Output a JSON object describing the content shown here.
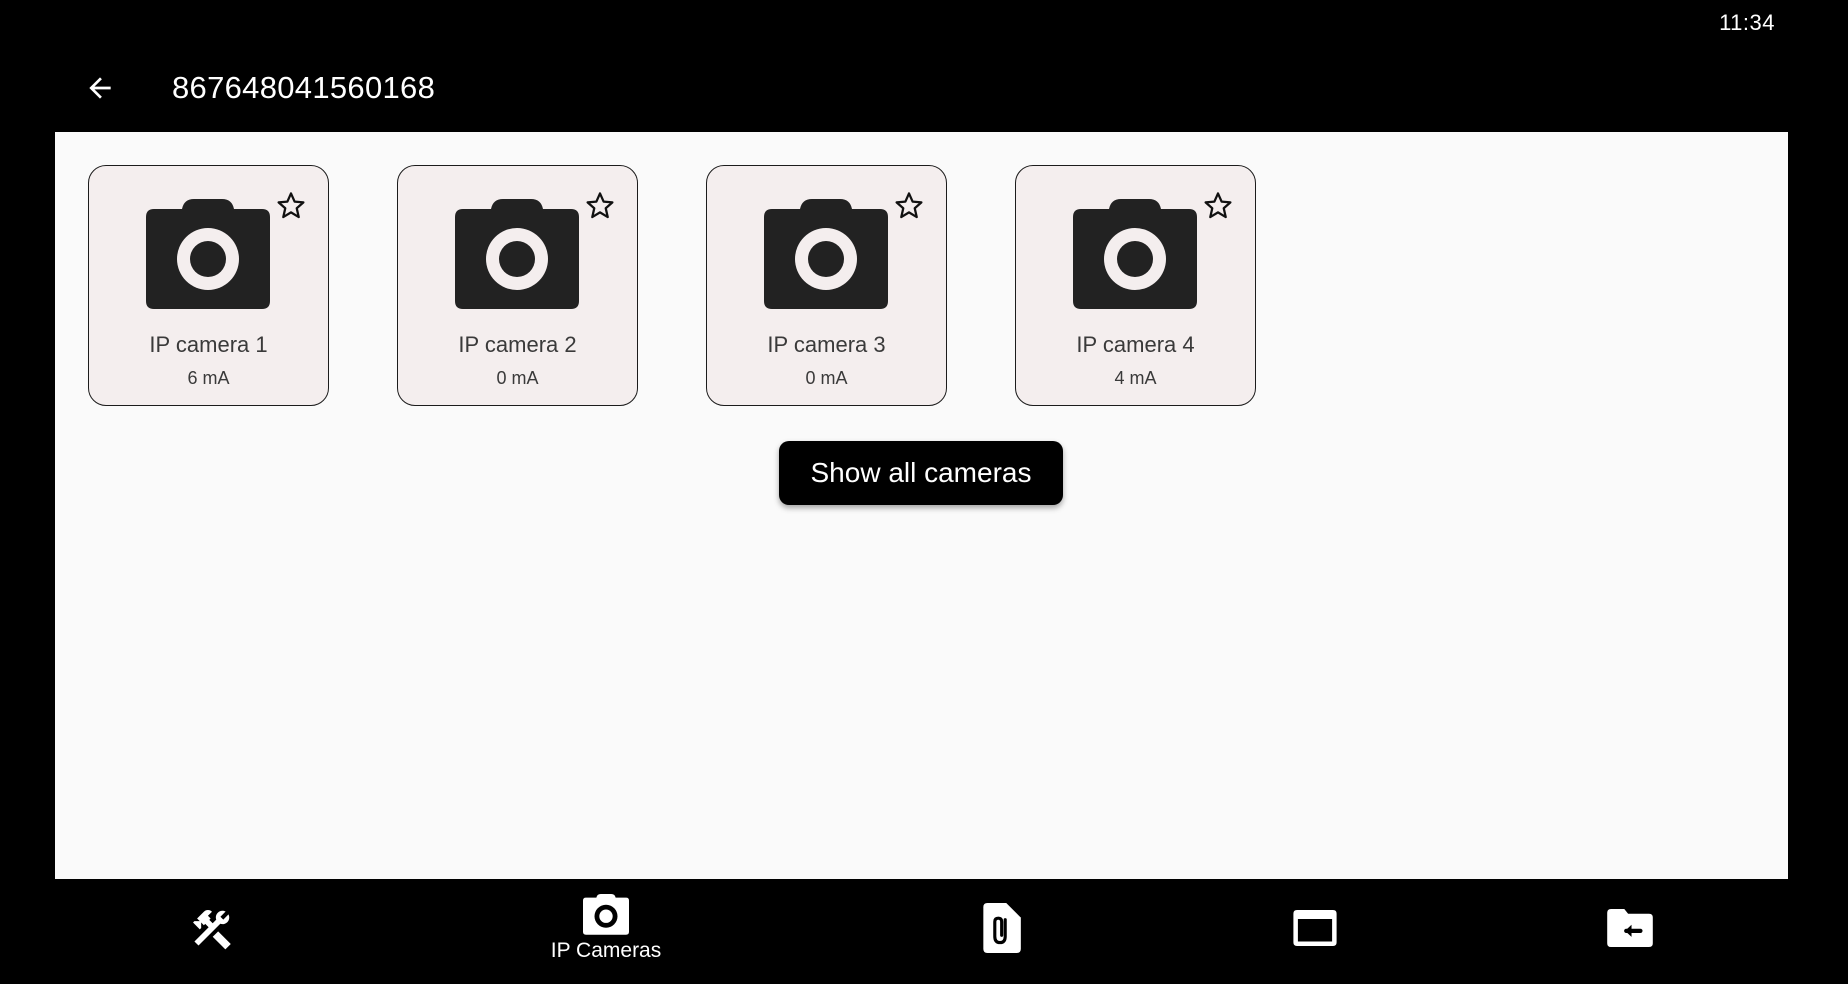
{
  "status_bar": {
    "time": "11:34"
  },
  "header": {
    "title": "867648041560168"
  },
  "cameras": [
    {
      "name": "IP camera 1",
      "current": "6 mA"
    },
    {
      "name": "IP camera 2",
      "current": "0 mA"
    },
    {
      "name": "IP camera 3",
      "current": "0 mA"
    },
    {
      "name": "IP camera 4",
      "current": "4 mA"
    }
  ],
  "show_all_button": {
    "label": "Show all cameras"
  },
  "bottom_nav": {
    "items": [
      {
        "icon": "tools-icon",
        "label": ""
      },
      {
        "icon": "camera-icon",
        "label": "IP Cameras"
      },
      {
        "icon": "attachment-file-icon",
        "label": ""
      },
      {
        "icon": "window-icon",
        "label": ""
      },
      {
        "icon": "folder-exit-icon",
        "label": ""
      }
    ]
  },
  "colors": {
    "background": "#000000",
    "content": "#fafafa",
    "card": "#f4eeee",
    "icon": "#222222"
  }
}
